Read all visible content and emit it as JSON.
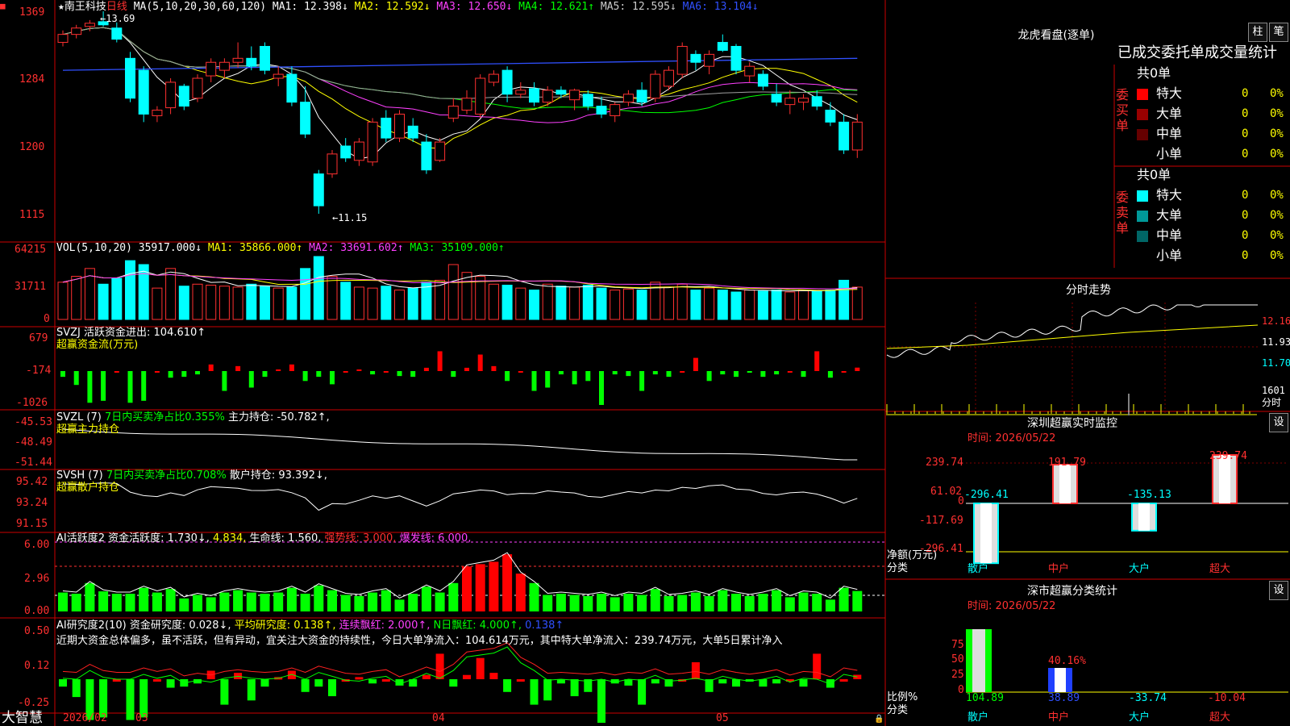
{
  "colors": {
    "up": "#ff3030",
    "down": "#00ffff",
    "frame": "#cc0000",
    "ma1": "#ffffff",
    "ma2": "#ffff00",
    "ma3": "#ff40ff",
    "ma4": "#00ff00",
    "ma5": "#a0a0a0",
    "ma6": "#3050ff"
  },
  "header": {
    "star": "★",
    "name": "南王科技",
    "period": "日线",
    "ma_label": "MA(5,10,20,30,60,120)",
    "ma1": "MA1: 12.398↓",
    "ma2": "MA2: 12.592↓",
    "ma3": "MA3: 12.650↓",
    "ma4": "MA4: 12.621↑",
    "ma5": "MA5: 12.595↓",
    "ma6": "MA6: 13.104↓"
  },
  "price_axis": [
    "1369",
    "1284",
    "1200",
    "1115"
  ],
  "price_marks": {
    "high": "13.69",
    "low": "11.15"
  },
  "vol": {
    "label": "VOL(5,10,20)",
    "value": "35917.000↓",
    "ma1": "MA1: 35866.000↑",
    "ma2": "MA2: 33691.602↑",
    "ma3": "MA3: 35109.000↑",
    "axis": [
      "64215",
      "31711",
      "0"
    ]
  },
  "svzj": {
    "label": "SVZJ  活跃资金进出: 104.610↑",
    "sub": "超赢资金流(万元)",
    "axis": [
      "679",
      "-174",
      "-1026"
    ]
  },
  "svzl": {
    "label": "SVZL (7)",
    "pct": "7日内买卖净占比0.355%",
    "hold": "主力持仓: -50.782↑,",
    "sub": "超赢主力持仓",
    "axis": [
      "-45.53",
      "-48.49",
      "-51.44"
    ]
  },
  "svsh": {
    "label": "SVSH (7)",
    "pct": "7日内买卖净占比0.708%",
    "hold": "散户持仓: 93.392↓,",
    "sub": "超赢散户持仓",
    "axis": [
      "95.42",
      "93.24",
      "91.15"
    ]
  },
  "ai_active": {
    "label": "AI活跃度2 资金活跃度: 1.730↓,",
    "v2": "4.834,",
    "life": "生命线: 1.560,",
    "strong": "强势线: 3.000,",
    "burst": "爆发线: 6.000,",
    "axis": [
      "6.00",
      "2.96",
      "0.00"
    ]
  },
  "ai_research": {
    "label": "AI研究度2(10) 资金研究度: 0.028↓,",
    "avg": "平均研究度: 0.138↑,",
    "lianxu": "连续飘红: 2.000↑,",
    "nday": "N日飘红: 4.000↑,",
    "last": "0.138↑",
    "note": "近期大资金总体偏多，虽不活跃，但有异动，宜关注大资金的持续性，今日大单净流入：104.614万元，其中特大单净流入：239.74万元，大单5日累计净入",
    "axis": [
      "0.50",
      "0.12",
      "-0.25"
    ]
  },
  "bottom": {
    "logo": "大智慧",
    "dates": [
      "2026/02",
      "03",
      "04",
      "05"
    ]
  },
  "dragon": {
    "title": "龙虎看盘(逐单)",
    "btn1": "柱",
    "btn2": "笔",
    "subtitle": "已成交委托单成交量统计",
    "buy": {
      "label": "委买单",
      "total": "共0单",
      "rows": [
        {
          "name": "特大",
          "v": "0",
          "p": "0%"
        },
        {
          "name": "大单",
          "v": "0",
          "p": "0%"
        },
        {
          "name": "中单",
          "v": "0",
          "p": "0%"
        },
        {
          "name": "小单",
          "v": "0",
          "p": "0%"
        }
      ]
    },
    "sell": {
      "label": "委卖单",
      "total": "共0单",
      "rows": [
        {
          "name": "特大",
          "v": "0",
          "p": "0%"
        },
        {
          "name": "大单",
          "v": "0",
          "p": "0%"
        },
        {
          "name": "中单",
          "v": "0",
          "p": "0%"
        },
        {
          "name": "小单",
          "v": "0",
          "p": "0%"
        }
      ]
    }
  },
  "intraday": {
    "title": "分时走势",
    "axis": [
      "12.16",
      "11.93",
      "11.70"
    ],
    "vol_top": "1601",
    "vol_label": "分时"
  },
  "sz_monitor": {
    "title": "深圳超赢实时监控",
    "btn": "设",
    "time": "时间: 2026/05/22",
    "axis": [
      "239.74",
      "61.02",
      "0",
      "-117.69",
      "-296.41"
    ],
    "ylabel1": "净额(万元)",
    "ylabel2": "分类",
    "cats": [
      "散户",
      "中户",
      "大户",
      "超大"
    ],
    "values": [
      "-296.41",
      "191.79",
      "-135.13",
      "239.74"
    ]
  },
  "sz_class": {
    "title": "深市超赢分类统计",
    "btn": "设",
    "time": "时间: 2026/05/22",
    "axis": [
      "75",
      "50",
      "25",
      "0"
    ],
    "ylabel1": "比例%",
    "ylabel2": "分类",
    "cats": [
      "散户",
      "中户",
      "大户",
      "超大"
    ],
    "values": [
      "104.89",
      "38.89",
      "-33.74",
      "-10.04"
    ],
    "bar_label": "40.16%"
  },
  "chart_data": {
    "type": "candlestick",
    "price_range": [
      11.0,
      13.8
    ],
    "ohlc": [
      [
        13.3,
        13.45,
        13.25,
        13.4
      ],
      [
        13.4,
        13.52,
        13.35,
        13.48
      ],
      [
        13.5,
        13.58,
        13.44,
        13.54
      ],
      [
        13.56,
        13.69,
        13.5,
        13.52
      ],
      [
        13.48,
        13.55,
        13.3,
        13.34
      ],
      [
        13.1,
        13.18,
        12.55,
        12.6
      ],
      [
        12.95,
        13.0,
        12.3,
        12.4
      ],
      [
        12.38,
        12.5,
        12.3,
        12.45
      ],
      [
        12.48,
        12.85,
        12.4,
        12.8
      ],
      [
        12.75,
        12.78,
        12.45,
        12.5
      ],
      [
        12.6,
        12.9,
        12.55,
        12.85
      ],
      [
        12.88,
        13.1,
        12.8,
        13.05
      ],
      [
        12.95,
        13.1,
        12.85,
        13.05
      ],
      [
        13.05,
        13.3,
        12.98,
        13.1
      ],
      [
        13.1,
        13.25,
        12.95,
        13.0
      ],
      [
        13.25,
        13.3,
        12.9,
        12.95
      ],
      [
        12.85,
        13.0,
        12.75,
        12.9
      ],
      [
        12.9,
        13.0,
        12.5,
        12.55
      ],
      [
        12.55,
        12.75,
        12.1,
        12.15
      ],
      [
        11.65,
        11.7,
        11.15,
        11.25
      ],
      [
        11.65,
        11.95,
        11.6,
        11.9
      ],
      [
        12.0,
        12.1,
        11.8,
        11.85
      ],
      [
        11.82,
        12.1,
        11.75,
        12.05
      ],
      [
        11.8,
        12.35,
        11.75,
        12.3
      ],
      [
        12.35,
        12.45,
        12.05,
        12.1
      ],
      [
        12.1,
        12.45,
        12.05,
        12.4
      ],
      [
        12.25,
        12.35,
        12.05,
        12.1
      ],
      [
        12.05,
        12.15,
        11.65,
        11.7
      ],
      [
        11.82,
        12.1,
        11.8,
        12.05
      ],
      [
        12.35,
        12.6,
        12.3,
        12.5
      ],
      [
        12.45,
        12.7,
        12.4,
        12.6
      ],
      [
        12.4,
        12.9,
        12.35,
        12.85
      ],
      [
        12.8,
        12.95,
        12.75,
        12.9
      ],
      [
        12.95,
        13.0,
        12.55,
        12.65
      ],
      [
        12.65,
        12.8,
        12.6,
        12.7
      ],
      [
        12.72,
        12.8,
        12.5,
        12.55
      ],
      [
        12.55,
        12.75,
        12.5,
        12.7
      ],
      [
        12.7,
        12.75,
        12.6,
        12.65
      ],
      [
        12.58,
        12.72,
        12.45,
        12.7
      ],
      [
        12.65,
        12.7,
        12.45,
        12.5
      ],
      [
        12.5,
        12.62,
        12.35,
        12.4
      ],
      [
        12.38,
        12.55,
        12.3,
        12.52
      ],
      [
        12.55,
        12.7,
        12.5,
        12.65
      ],
      [
        12.7,
        12.8,
        12.5,
        12.55
      ],
      [
        12.6,
        12.95,
        12.55,
        12.9
      ],
      [
        12.75,
        13.0,
        12.7,
        12.95
      ],
      [
        12.9,
        13.3,
        12.85,
        13.25
      ],
      [
        13.15,
        13.2,
        12.95,
        13.05
      ],
      [
        13.0,
        13.2,
        12.9,
        13.15
      ],
      [
        13.3,
        13.4,
        13.18,
        13.2
      ],
      [
        13.25,
        13.28,
        12.9,
        12.95
      ],
      [
        12.88,
        13.05,
        12.8,
        13.0
      ],
      [
        12.9,
        12.95,
        12.7,
        12.75
      ],
      [
        12.65,
        12.78,
        12.5,
        12.55
      ],
      [
        12.52,
        12.7,
        12.4,
        12.6
      ],
      [
        12.55,
        12.65,
        12.45,
        12.6
      ],
      [
        12.62,
        12.7,
        12.45,
        12.5
      ],
      [
        12.45,
        12.55,
        12.25,
        12.3
      ],
      [
        12.3,
        12.4,
        11.9,
        11.95
      ],
      [
        11.95,
        12.4,
        11.85,
        12.3
      ]
    ],
    "volume": [
      38000,
      44000,
      52000,
      36000,
      42000,
      60000,
      56000,
      32000,
      52000,
      34000,
      36000,
      35000,
      34000,
      33000,
      36000,
      34000,
      32000,
      33000,
      52000,
      64215,
      44000,
      38000,
      33000,
      32000,
      34000,
      30000,
      32000,
      38000,
      40000,
      56000,
      48000,
      44000,
      36000,
      35000,
      32000,
      30000,
      36000,
      34000,
      33000,
      35000,
      32000,
      30000,
      31000,
      30000,
      38000,
      33000,
      36000,
      30000,
      32000,
      30000,
      28000,
      30000,
      29000,
      30000,
      28000,
      30000,
      29000,
      30000,
      40000,
      33000
    ],
    "active_fund": [
      -174,
      -420,
      -960,
      -900,
      0,
      -960,
      -900,
      0,
      -200,
      -174,
      -100,
      200,
      -600,
      150,
      -500,
      -174,
      50,
      200,
      -300,
      -174,
      -400,
      0,
      50,
      -100,
      0,
      -150,
      -174,
      100,
      600,
      -174,
      100,
      500,
      150,
      -300,
      0,
      -600,
      -500,
      -100,
      -400,
      -300,
      -1026,
      -100,
      -150,
      -600,
      -100,
      -174,
      0,
      400,
      -300,
      -100,
      -174,
      -50,
      -174,
      -100,
      0,
      -174,
      600,
      -200,
      0,
      104.61
    ],
    "ai_active_values": [
      1.6,
      1.5,
      2.4,
      1.7,
      1.5,
      1.5,
      2.0,
      1.6,
      1.9,
      1.1,
      1.4,
      1.2,
      1.6,
      1.8,
      1.6,
      1.5,
      1.6,
      2.0,
      1.5,
      2.2,
      1.8,
      1.4,
      1.3,
      1.6,
      1.8,
      1.0,
      1.5,
      2.1,
      1.6,
      2.4,
      3.8,
      4.0,
      4.2,
      4.834,
      3.2,
      2.4,
      1.4,
      1.5,
      1.4,
      1.3,
      1.5,
      1.2,
      1.5,
      1.4,
      1.9,
      1.3,
      1.4,
      1.6,
      1.3,
      1.8,
      1.5,
      1.3,
      1.5,
      1.8,
      1.2,
      1.6,
      1.5,
      1.0,
      2.0,
      1.73
    ]
  }
}
